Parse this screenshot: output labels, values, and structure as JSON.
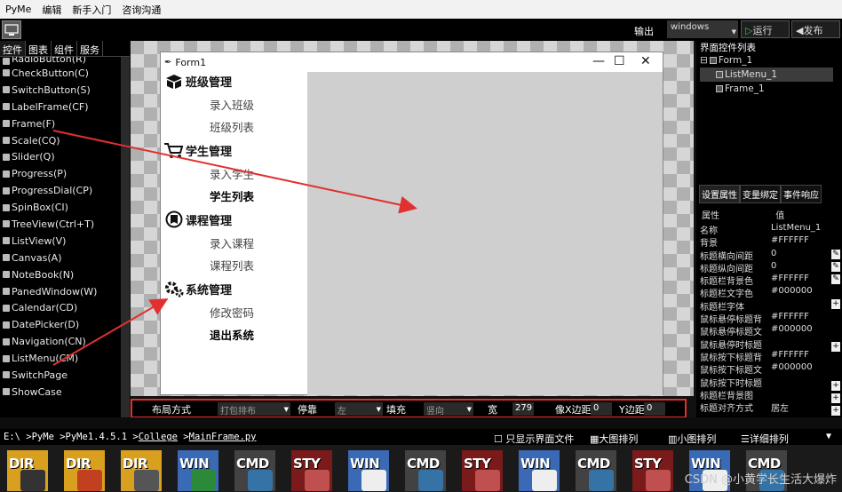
{
  "menubar": [
    "PyMe",
    "编辑",
    "新手入门",
    "咨询沟通"
  ],
  "toolbar": {
    "output_label": "输出",
    "os_select_value": "windows",
    "run_label": "运行",
    "publish_label": "发布"
  },
  "left_tabs": [
    "控件",
    "图表",
    "组件",
    "服务"
  ],
  "components": [
    "RadioButton(R)",
    "CheckButton(C)",
    "SwitchButton(S)",
    "LabelFrame(CF)",
    "Frame(F)",
    "Scale(CQ)",
    "Slider(Q)",
    "Progress(P)",
    "ProgressDial(CP)",
    "SpinBox(CI)",
    "TreeView(Ctrl+T)",
    "ListView(V)",
    "Canvas(A)",
    "NoteBook(N)",
    "PanedWindow(W)",
    "Calendar(CD)",
    "DatePicker(D)",
    "Navigation(CN)",
    "ListMenu(CM)",
    "SwitchPage",
    "ShowCase"
  ],
  "form": {
    "title": "Form1",
    "groups": [
      {
        "title": "班级管理",
        "icon": "box-icon",
        "items": [
          {
            "label": "录入班级",
            "bold": false
          },
          {
            "label": "班级列表",
            "bold": false
          }
        ]
      },
      {
        "title": "学生管理",
        "icon": "cart-icon",
        "items": [
          {
            "label": "录入学生",
            "bold": false
          },
          {
            "label": "学生列表",
            "bold": true
          }
        ]
      },
      {
        "title": "课程管理",
        "icon": "course-icon",
        "items": [
          {
            "label": "录入课程",
            "bold": false
          },
          {
            "label": "课程列表",
            "bold": false
          }
        ]
      },
      {
        "title": "系统管理",
        "icon": "gear-icon",
        "items": [
          {
            "label": "修改密码",
            "bold": false
          },
          {
            "label": "退出系统",
            "bold": true
          }
        ]
      }
    ]
  },
  "propbar": {
    "layout_label": "布局方式",
    "layout_value": "打包排布",
    "dock_label": "停靠",
    "dock_value": "左",
    "fill_label": "填充",
    "fill_value": "竖向",
    "width_label": "宽",
    "width_value": "279",
    "padx_label": "像X边距",
    "padx_value": "0",
    "pady_label": "Y边距",
    "pady_value": "0"
  },
  "right_panel": {
    "tree_title": "界面控件列表",
    "tree": [
      {
        "label": "Form_1",
        "selected": false,
        "indent": 0
      },
      {
        "label": "ListMenu_1",
        "selected": true,
        "indent": 1
      },
      {
        "label": "Frame_1",
        "selected": false,
        "indent": 1
      }
    ],
    "prop_tabs": [
      "设置属性",
      "变量绑定",
      "事件响应"
    ],
    "prop_header": {
      "key": "属性",
      "value": "值"
    },
    "props": [
      {
        "key": "名称",
        "value": "ListMenu_1"
      },
      {
        "key": "背景",
        "value": "#FFFFFF"
      },
      {
        "key": "标题横向间距",
        "value": "0"
      },
      {
        "key": "标题纵向间距",
        "value": "0"
      },
      {
        "key": "标题栏背景色",
        "value": "#FFFFFF"
      },
      {
        "key": "标题栏文字色",
        "value": "#000000"
      },
      {
        "key": "标题栏字体",
        "value": ""
      },
      {
        "key": "鼠标悬停标题背",
        "value": "#FFFFFF"
      },
      {
        "key": "鼠标悬停标题文",
        "value": "#000000"
      },
      {
        "key": "鼠标悬停时标题",
        "value": ""
      },
      {
        "key": "鼠标按下标题背",
        "value": "#FFFFFF"
      },
      {
        "key": "鼠标按下标题文",
        "value": "#000000"
      },
      {
        "key": "鼠标按下时标题",
        "value": ""
      },
      {
        "key": "标题栏背景图",
        "value": ""
      },
      {
        "key": "标题对齐方式",
        "value": "居左"
      }
    ]
  },
  "pathbar": {
    "path_prefix": "E:\\ >PyMe >PyMe1.4.5.1 >",
    "path_college": "College",
    "path_sep": " >",
    "path_file": "MainFrame.py",
    "only_ui": "只显示界面文件",
    "large_icons": "大图排列",
    "small_icons": "小图排列",
    "detail": "详细排列"
  },
  "files": [
    {
      "type": "DIR",
      "badge": "stack"
    },
    {
      "type": "DIR",
      "badge": "bulb"
    },
    {
      "type": "DIR",
      "badge": "search"
    },
    {
      "type": "WIN",
      "badge": "snake"
    },
    {
      "type": "CMD",
      "badge": "python"
    },
    {
      "type": "STY",
      "badge": "sty"
    },
    {
      "type": "WIN",
      "badge": "window"
    },
    {
      "type": "CMD",
      "badge": "python"
    },
    {
      "type": "STY",
      "badge": "sty"
    },
    {
      "type": "WIN",
      "badge": "window"
    },
    {
      "type": "CMD",
      "badge": "python"
    },
    {
      "type": "STY",
      "badge": "sty"
    },
    {
      "type": "WIN",
      "badge": "window"
    },
    {
      "type": "CMD",
      "badge": "python"
    }
  ],
  "watermark": "CSDN @小黄学长生活大爆炸",
  "colors": {
    "highlight": "#e03030",
    "accent": "#3c3c3c"
  }
}
